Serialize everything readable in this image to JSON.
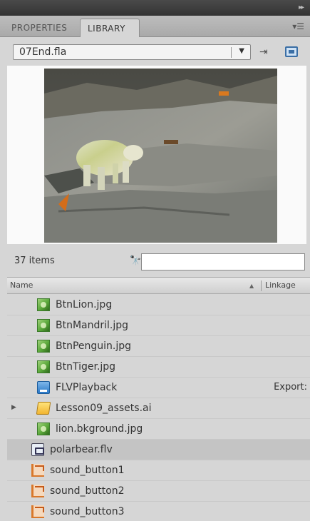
{
  "panel": {
    "tabs": [
      {
        "label": "PROPERTIES"
      },
      {
        "label": "LIBRARY"
      }
    ],
    "document_select": {
      "value": "07End.fla"
    },
    "items_count": "37 items",
    "search": {
      "placeholder": "",
      "value": ""
    }
  },
  "columns": {
    "name": "Name",
    "linkage": "Linkage"
  },
  "items": [
    {
      "name": "BtnLion.jpg",
      "icon": "bitmap-icon",
      "linkage": ""
    },
    {
      "name": "BtnMandril.jpg",
      "icon": "bitmap-icon",
      "linkage": ""
    },
    {
      "name": "BtnPenguin.jpg",
      "icon": "bitmap-icon",
      "linkage": ""
    },
    {
      "name": "BtnTiger.jpg",
      "icon": "bitmap-icon",
      "linkage": ""
    },
    {
      "name": "FLVPlayback",
      "icon": "component-icon",
      "linkage": "Export:"
    },
    {
      "name": "Lesson09_assets.ai",
      "icon": "folder-icon",
      "linkage": ""
    },
    {
      "name": "lion.bkground.jpg",
      "icon": "bitmap-icon",
      "linkage": ""
    },
    {
      "name": "polarbear.flv",
      "icon": "video-icon",
      "linkage": "",
      "selected": true
    },
    {
      "name": "sound_button1",
      "icon": "button-symbol-icon",
      "linkage": ""
    },
    {
      "name": "sound_button2",
      "icon": "button-symbol-icon",
      "linkage": ""
    },
    {
      "name": "sound_button3",
      "icon": "button-symbol-icon",
      "linkage": ""
    }
  ],
  "icons": {
    "panel_menu": "panel-menu-icon",
    "pin": "pin-icon",
    "new_library": "new-library-panel-icon",
    "search": "binoculars-icon",
    "sort": "sort-ascending-icon"
  }
}
